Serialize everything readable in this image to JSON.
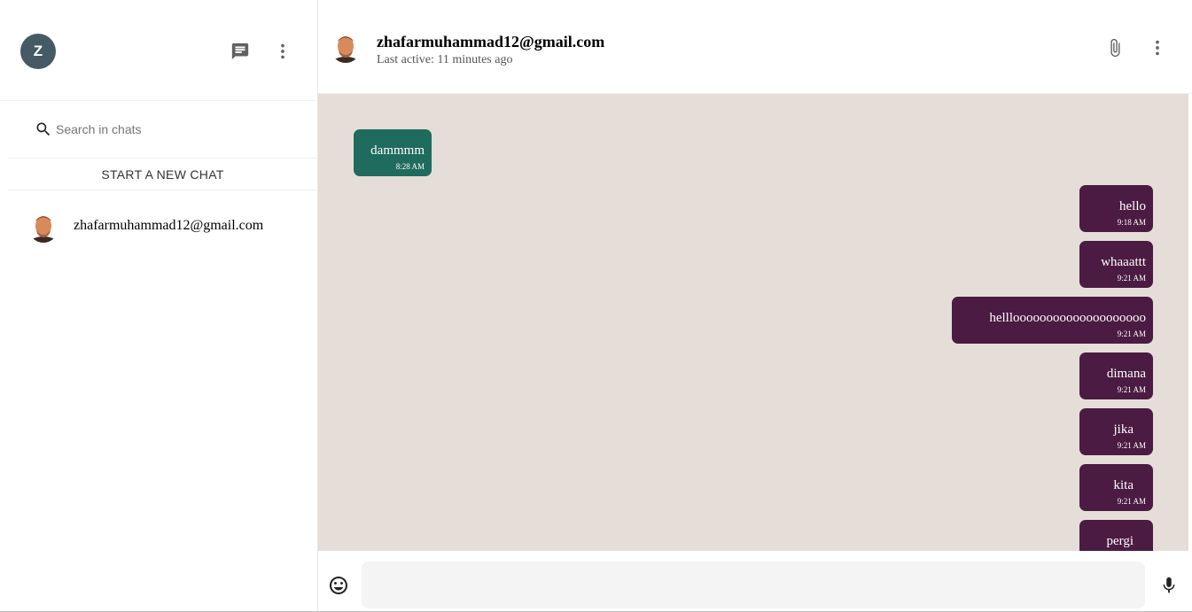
{
  "user": {
    "initial": "Z"
  },
  "sidebar": {
    "search_placeholder": "Search in chats",
    "new_chat_label": "START A NEW CHAT",
    "chats": [
      {
        "name": "zhafarmuhammad12@gmail.com"
      }
    ]
  },
  "conversation": {
    "contact_name": "zhafarmuhammad12@gmail.com",
    "last_active": "Last active: 11 minutes ago",
    "messages": [
      {
        "direction": "in",
        "text": "dammmm",
        "time": "8:28 AM"
      },
      {
        "direction": "out",
        "text": "hello",
        "time": "9:18 AM"
      },
      {
        "direction": "out",
        "text": "whaaattt",
        "time": "9:21 AM"
      },
      {
        "direction": "out",
        "text": "hellloooooooooooooooooooo",
        "time": "9:21 AM"
      },
      {
        "direction": "out",
        "text": "dimana",
        "time": "9:21 AM"
      },
      {
        "direction": "out",
        "text": "jika",
        "time": "9:21 AM"
      },
      {
        "direction": "out",
        "text": "kita",
        "time": "9:21 AM"
      },
      {
        "direction": "out",
        "text": "pergi",
        "time": ""
      }
    ]
  },
  "colors": {
    "incoming_bubble": "#1f6b5e",
    "outgoing_bubble": "#4b1b43",
    "chat_background": "#e5ded8",
    "avatar": "#455a64"
  },
  "icons": [
    "chat-icon",
    "more-vert-icon",
    "search-icon",
    "attach-icon",
    "emoji-icon",
    "mic-icon"
  ]
}
